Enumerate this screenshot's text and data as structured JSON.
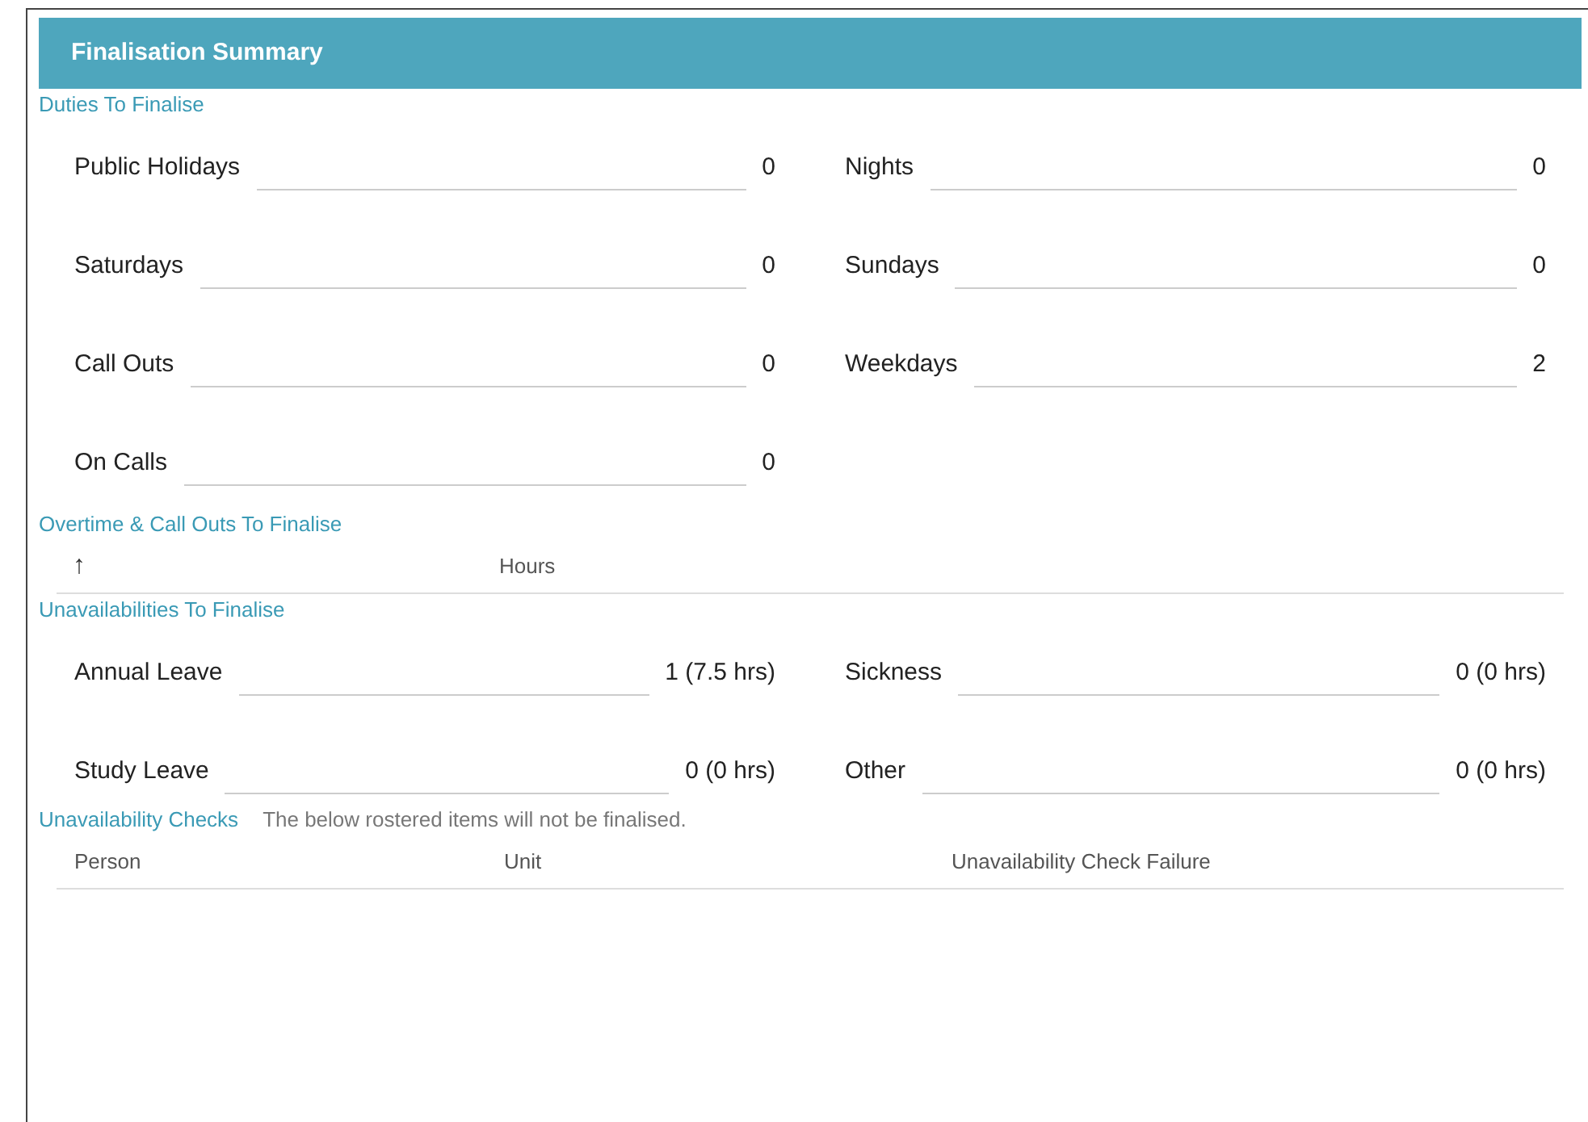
{
  "panel": {
    "title": "Finalisation Summary"
  },
  "duties": {
    "heading": "Duties To Finalise",
    "items": [
      {
        "label": "Public Holidays",
        "value": "0"
      },
      {
        "label": "Nights",
        "value": "0"
      },
      {
        "label": "Saturdays",
        "value": "0"
      },
      {
        "label": "Sundays",
        "value": "0"
      },
      {
        "label": "Call Outs",
        "value": "0"
      },
      {
        "label": "Weekdays",
        "value": "2"
      },
      {
        "label": "On Calls",
        "value": "0"
      }
    ]
  },
  "overtime": {
    "heading": "Overtime & Call Outs To Finalise",
    "columns": [
      {
        "label": "↑"
      },
      {
        "label": "Hours"
      }
    ]
  },
  "unavailabilities": {
    "heading": "Unavailabilities To Finalise",
    "items": [
      {
        "label": "Annual Leave",
        "value": "1 (7.5 hrs)"
      },
      {
        "label": "Sickness",
        "value": "0 (0 hrs)"
      },
      {
        "label": "Study Leave",
        "value": "0 (0 hrs)"
      },
      {
        "label": "Other",
        "value": "0 (0 hrs)"
      }
    ]
  },
  "checks": {
    "heading": "Unavailability Checks",
    "note": "The below rostered items will not be finalised.",
    "columns": [
      {
        "label": "Person"
      },
      {
        "label": "Unit"
      },
      {
        "label": "Unavailability Check Failure"
      }
    ]
  }
}
